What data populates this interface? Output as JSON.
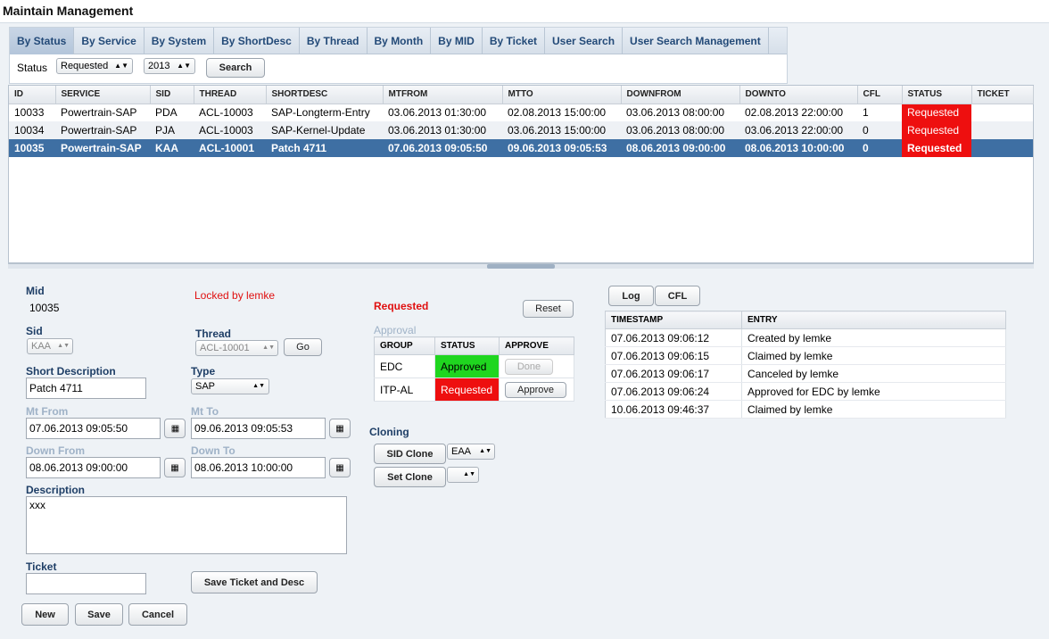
{
  "page": {
    "title": "Maintain Management"
  },
  "tabs": [
    {
      "label": "By Status",
      "active": true
    },
    {
      "label": "By Service"
    },
    {
      "label": "By System"
    },
    {
      "label": "By ShortDesc"
    },
    {
      "label": "By Thread"
    },
    {
      "label": "By Month"
    },
    {
      "label": "By MID"
    },
    {
      "label": "By Ticket"
    },
    {
      "label": "User Search"
    },
    {
      "label": "User Search Management"
    }
  ],
  "filter": {
    "status_label": "Status",
    "status_value": "Requested",
    "year_value": "2013",
    "search_label": "Search"
  },
  "main_table": {
    "columns": [
      "ID",
      "SERVICE",
      "SID",
      "THREAD",
      "SHORTDESC",
      "MTFROM",
      "MTTO",
      "DOWNFROM",
      "DOWNTO",
      "CFL",
      "STATUS",
      "TICKET"
    ],
    "rows": [
      [
        "10033",
        "Powertrain-SAP",
        "PDA",
        "ACL-10003",
        "SAP-Longterm-Entry",
        "03.06.2013 01:30:00",
        "02.08.2013 15:00:00",
        "03.06.2013 08:00:00",
        "02.08.2013 22:00:00",
        "1",
        "Requested",
        ""
      ],
      [
        "10034",
        "Powertrain-SAP",
        "PJA",
        "ACL-10003",
        "SAP-Kernel-Update",
        "03.06.2013 01:30:00",
        "03.06.2013 15:00:00",
        "03.06.2013 08:00:00",
        "03.06.2013 22:00:00",
        "0",
        "Requested",
        ""
      ],
      [
        "10035",
        "Powertrain-SAP",
        "KAA",
        "ACL-10001",
        "Patch 4711",
        "07.06.2013 09:05:50",
        "09.06.2013 09:05:53",
        "08.06.2013 09:00:00",
        "08.06.2013 10:00:00",
        "0",
        "Requested",
        ""
      ]
    ],
    "selected_row": 2
  },
  "form": {
    "mid_label": "Mid",
    "mid_value": "10035",
    "locked_text": "Locked by lemke",
    "sid_label": "Sid",
    "sid_value": "KAA",
    "thread_label": "Thread",
    "thread_value": "ACL-10001",
    "go_label": "Go",
    "shortdesc_label": "Short Description",
    "shortdesc_value": "Patch 4711",
    "type_label": "Type",
    "type_value": "SAP",
    "mtfrom_label": "Mt From",
    "mtfrom_value": "07.06.2013 09:05:50",
    "mtto_label": "Mt To",
    "mtto_value": "09.06.2013 09:05:53",
    "downfrom_label": "Down From",
    "downfrom_value": "08.06.2013 09:00:00",
    "downto_label": "Down To",
    "downto_value": "08.06.2013 10:00:00",
    "description_label": "Description",
    "description_value": "xxx",
    "ticket_label": "Ticket",
    "ticket_value": "",
    "save_ticket_label": "Save Ticket and Desc",
    "new_label": "New",
    "save_label": "Save",
    "cancel_label": "Cancel"
  },
  "approval": {
    "status_text": "Requested",
    "reset_label": "Reset",
    "section_label": "Approval",
    "columns": [
      "GROUP",
      "STATUS",
      "APPROVE"
    ],
    "rows": [
      {
        "group": "EDC",
        "status": "Approved",
        "action": "Done"
      },
      {
        "group": "ITP-AL",
        "status": "Requested",
        "action": "Approve"
      }
    ]
  },
  "cloning": {
    "label": "Cloning",
    "sid_clone_label": "SID Clone",
    "sid_clone_value": "EAA",
    "set_clone_label": "Set Clone",
    "set_clone_value": ""
  },
  "log": {
    "log_tab": "Log",
    "cfl_tab": "CFL",
    "columns": [
      "TIMESTAMP",
      "ENTRY"
    ],
    "rows": [
      [
        "07.06.2013 09:06:12",
        "Created by lemke"
      ],
      [
        "07.06.2013 09:06:15",
        "Claimed by lemke"
      ],
      [
        "07.06.2013 09:06:17",
        "Canceled by lemke"
      ],
      [
        "07.06.2013 09:06:24",
        "Approved for EDC by lemke"
      ],
      [
        "10.06.2013 09:46:37",
        "Claimed by lemke"
      ]
    ]
  },
  "colors": {
    "accent": "#3e6fa3",
    "requested": "#ee0f0f",
    "approved": "#1fd61f",
    "label": "#1e3e66",
    "locked": "#e01010"
  }
}
